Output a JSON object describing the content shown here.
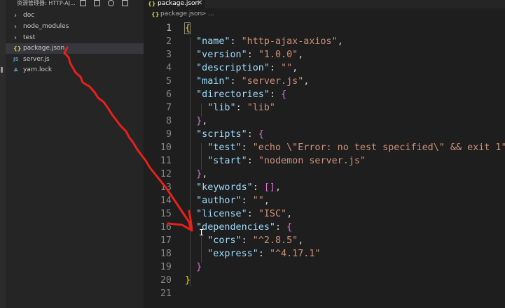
{
  "explorer": {
    "header_title": "资源管理器: HTTP-AJ...",
    "tools": [
      "new-file-icon",
      "new-folder-icon",
      "refresh-icon",
      "collapse-all-icon"
    ],
    "items": [
      {
        "label": "doc",
        "kind": "folder",
        "icon": "chevron-right-icon"
      },
      {
        "label": "node_modules",
        "kind": "folder",
        "icon": "chevron-right-icon"
      },
      {
        "label": "test",
        "kind": "folder",
        "icon": "chevron-right-icon"
      },
      {
        "label": "package.json",
        "kind": "json",
        "icon": "{}",
        "selected": true
      },
      {
        "label": "server.js",
        "kind": "js",
        "icon": "JS"
      },
      {
        "label": "yarn.lock",
        "kind": "yarn",
        "icon": "yarn-icon"
      }
    ]
  },
  "editor": {
    "tab_icon": "{}",
    "tab_label": "package.json",
    "tab_close": "✕",
    "breadcrumb_icon": "{}",
    "breadcrumb": [
      "package.json",
      ">",
      "..."
    ],
    "active_line": 1,
    "lines": [
      [
        [
          "b1",
          "{"
        ]
      ],
      [
        [
          "p",
          "  "
        ],
        [
          "k",
          "\"name\""
        ],
        [
          "p",
          ": "
        ],
        [
          "s",
          "\"http-ajax-axios\""
        ],
        [
          "p",
          ","
        ]
      ],
      [
        [
          "p",
          "  "
        ],
        [
          "k",
          "\"version\""
        ],
        [
          "p",
          ": "
        ],
        [
          "s",
          "\"1.0.0\""
        ],
        [
          "p",
          ","
        ]
      ],
      [
        [
          "p",
          "  "
        ],
        [
          "k",
          "\"description\""
        ],
        [
          "p",
          ": "
        ],
        [
          "s",
          "\"\""
        ],
        [
          "p",
          ","
        ]
      ],
      [
        [
          "p",
          "  "
        ],
        [
          "k",
          "\"main\""
        ],
        [
          "p",
          ": "
        ],
        [
          "s",
          "\"server.js\""
        ],
        [
          "p",
          ","
        ]
      ],
      [
        [
          "p",
          "  "
        ],
        [
          "k",
          "\"directories\""
        ],
        [
          "p",
          ": "
        ],
        [
          "b2",
          "{"
        ]
      ],
      [
        [
          "p",
          "    "
        ],
        [
          "k",
          "\"lib\""
        ],
        [
          "p",
          ": "
        ],
        [
          "s",
          "\"lib\""
        ]
      ],
      [
        [
          "p",
          "  "
        ],
        [
          "b2",
          "}"
        ],
        [
          "p",
          ","
        ]
      ],
      [
        [
          "p",
          "  "
        ],
        [
          "k",
          "\"scripts\""
        ],
        [
          "p",
          ": "
        ],
        [
          "b2",
          "{"
        ]
      ],
      [
        [
          "p",
          "    "
        ],
        [
          "k",
          "\"test\""
        ],
        [
          "p",
          ": "
        ],
        [
          "s",
          "\"echo \\\"Error: no test specified\\\" && exit 1\""
        ],
        [
          "p",
          ","
        ]
      ],
      [
        [
          "p",
          "    "
        ],
        [
          "k",
          "\"start\""
        ],
        [
          "p",
          ": "
        ],
        [
          "s",
          "\"nodemon server.js\""
        ]
      ],
      [
        [
          "p",
          "  "
        ],
        [
          "b2",
          "}"
        ],
        [
          "p",
          ","
        ]
      ],
      [
        [
          "p",
          "  "
        ],
        [
          "k",
          "\"keywords\""
        ],
        [
          "p",
          ": "
        ],
        [
          "b2",
          "[]"
        ],
        [
          "p",
          ","
        ]
      ],
      [
        [
          "p",
          "  "
        ],
        [
          "k",
          "\"author\""
        ],
        [
          "p",
          ": "
        ],
        [
          "s",
          "\"\""
        ],
        [
          "p",
          ","
        ]
      ],
      [
        [
          "p",
          "  "
        ],
        [
          "k",
          "\"license\""
        ],
        [
          "p",
          ": "
        ],
        [
          "s",
          "\"ISC\""
        ],
        [
          "p",
          ","
        ]
      ],
      [
        [
          "p",
          "  "
        ],
        [
          "k",
          "\"dependencies\""
        ],
        [
          "p",
          ": "
        ],
        [
          "b2",
          "{"
        ]
      ],
      [
        [
          "p",
          "    "
        ],
        [
          "k",
          "\"cors\""
        ],
        [
          "p",
          ": "
        ],
        [
          "s",
          "\"^2.8.5\""
        ],
        [
          "p",
          ","
        ]
      ],
      [
        [
          "p",
          "    "
        ],
        [
          "k",
          "\"express\""
        ],
        [
          "p",
          ": "
        ],
        [
          "s",
          "\"^4.17.1\""
        ]
      ],
      [
        [
          "p",
          "  "
        ],
        [
          "b2",
          "}"
        ]
      ],
      [
        [
          "b1",
          "}"
        ]
      ],
      []
    ]
  },
  "colors": {
    "key": "#9cdcfe",
    "string": "#ce9178",
    "punct": "#d4d4d4",
    "brace_outer": "#ffd700",
    "brace_inner": "#da70d6",
    "annotation_arrow": "#e8201a"
  }
}
